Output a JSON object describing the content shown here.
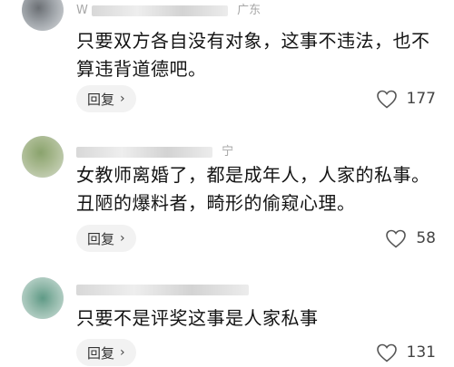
{
  "comments": [
    {
      "meta_partial": "W",
      "meta_location": "广东",
      "text": "只要双方各自没有对象，这事不违法，也不算违背道德吧。",
      "reply_label": "回复",
      "likes": "177"
    },
    {
      "meta_partial": "",
      "meta_location": "宁",
      "text": "女教师离婚了，都是成年人，人家的私事。丑陋的爆料者，畸形的偷窥心理。",
      "reply_label": "回复",
      "likes": "58"
    },
    {
      "meta_partial": "",
      "meta_location": "",
      "text": "只要不是评奖这事是人家私事",
      "reply_label": "回复",
      "likes": "131"
    }
  ],
  "icons": {
    "reply_chevron": "chevron-right-icon",
    "like": "heart-icon"
  },
  "colors": {
    "meta": "#a7a7a7",
    "reply_bg": "#f2f2f2",
    "text": "#141414"
  }
}
